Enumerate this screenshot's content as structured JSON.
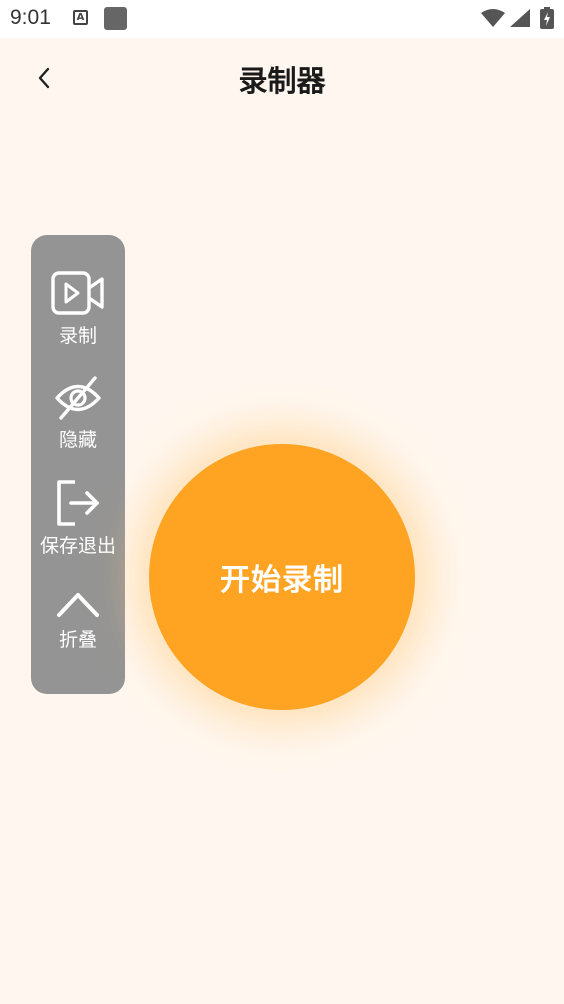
{
  "status_bar": {
    "time": "9:01",
    "a_badge": "A",
    "icons": [
      "a-notification-icon",
      "square-notification-icon",
      "wifi-icon",
      "signal-icon",
      "battery-charging-icon"
    ]
  },
  "header": {
    "title": "录制器",
    "back_icon": "chevron-left-icon"
  },
  "toolbar": {
    "items": [
      {
        "label": "录制",
        "icon": "video-camera-icon"
      },
      {
        "label": "隐藏",
        "icon": "eye-off-icon"
      },
      {
        "label": "保存退出",
        "icon": "exit-icon"
      },
      {
        "label": "折叠",
        "icon": "chevron-up-icon"
      }
    ]
  },
  "record_button": {
    "label": "开始录制"
  },
  "colors": {
    "background": "#fff7ef",
    "accent": "#ffa322",
    "panel": "#949494",
    "title": "#1a1a1a"
  }
}
